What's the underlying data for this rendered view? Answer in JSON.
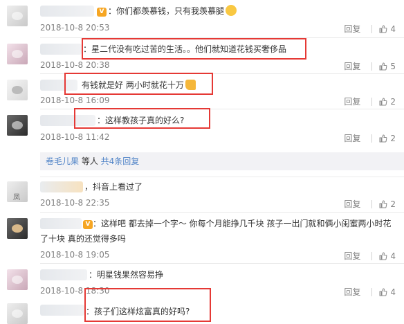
{
  "comments": [
    {
      "text": "：你们都羡慕钱，只有我羡慕腿",
      "time": "2018-10-8 20:53",
      "reply": "回复",
      "likes": "4"
    },
    {
      "text": "：星二代没有吃过苦的生活。。他们就知道花钱买奢侈品",
      "time": "2018-10-8 20:38",
      "reply": "回复",
      "likes": "5"
    },
    {
      "text": "有钱就是好 两小时就花十万",
      "time": "2018-10-8 16:09",
      "reply": "回复",
      "likes": "2"
    },
    {
      "text": "：这样教孩子真的好么?",
      "time": "2018-10-8 11:42",
      "reply": "回复",
      "likes": "2"
    },
    {
      "text": "，抖音上看过了",
      "time": "2018-10-8 22:35",
      "reply": "回复",
      "likes": "2"
    },
    {
      "text_line1": "：这样吧 都去掉一个字～ 你每个月能挣几千块 孩子一出门就和俩小闺蜜两小时花",
      "text_line2": "了十块 真的还觉得多吗",
      "time": "2018-10-8 19:05",
      "reply": "回复",
      "likes": "4"
    },
    {
      "text": "：明星钱果然容易挣",
      "time": "2018-10-8 18:30",
      "reply": "回复",
      "likes": "4"
    },
    {
      "text": "：孩子们这样炫富真的好吗?"
    }
  ],
  "replies_summary": {
    "user": "卷毛儿果",
    "middle": " 等人 ",
    "count_link": "共4条回复"
  },
  "avatar_label": "凤",
  "vip_label": "V",
  "colors": {
    "link": "#5285c8",
    "highlight_border": "#e53935",
    "meta": "#808080"
  },
  "icons": [
    "thumbs-up-icon",
    "vip-badge-icon",
    "emoji-icon",
    "thumb-emoji-icon"
  ]
}
